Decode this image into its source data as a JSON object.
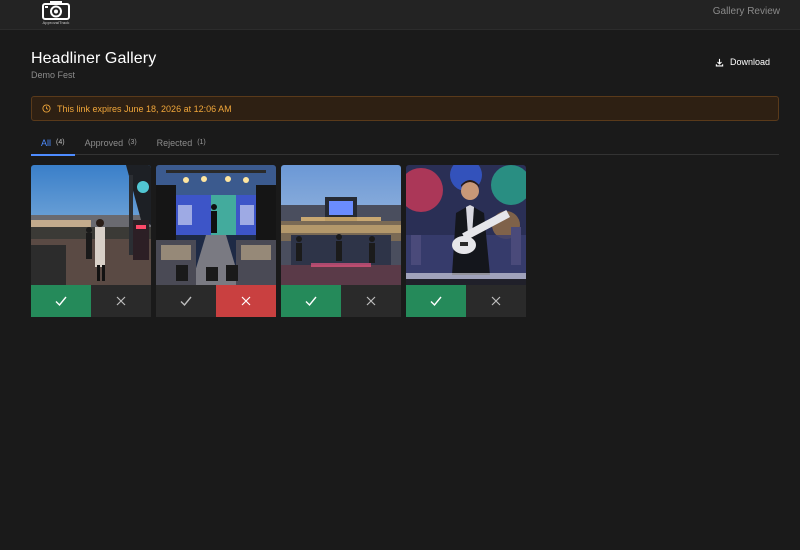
{
  "app": {
    "logo_text": "ApprovalTrack",
    "header_title": "Gallery Review"
  },
  "gallery": {
    "title": "Headliner Gallery",
    "subtitle": "Demo Fest",
    "download_label": "Download"
  },
  "notice": {
    "text": "This link expires June 18, 2026 at 12:06 AM",
    "color": "#f0a63a"
  },
  "tabs": [
    {
      "label": "All",
      "count": "(4)",
      "active": true
    },
    {
      "label": "Approved",
      "count": "(3)",
      "active": false
    },
    {
      "label": "Rejected",
      "count": "(1)",
      "active": false
    }
  ],
  "photos": [
    {
      "subject": "band-on-stage-wide",
      "status": "approved"
    },
    {
      "subject": "performer-on-runway",
      "status": "rejected"
    },
    {
      "subject": "stage-from-crowd",
      "status": "approved"
    },
    {
      "subject": "guitarist-closeup",
      "status": "approved"
    }
  ],
  "colors": {
    "accent": "#4e8cff",
    "approved": "#258a5a",
    "rejected": "#c94040",
    "background": "#1a1a1a"
  }
}
